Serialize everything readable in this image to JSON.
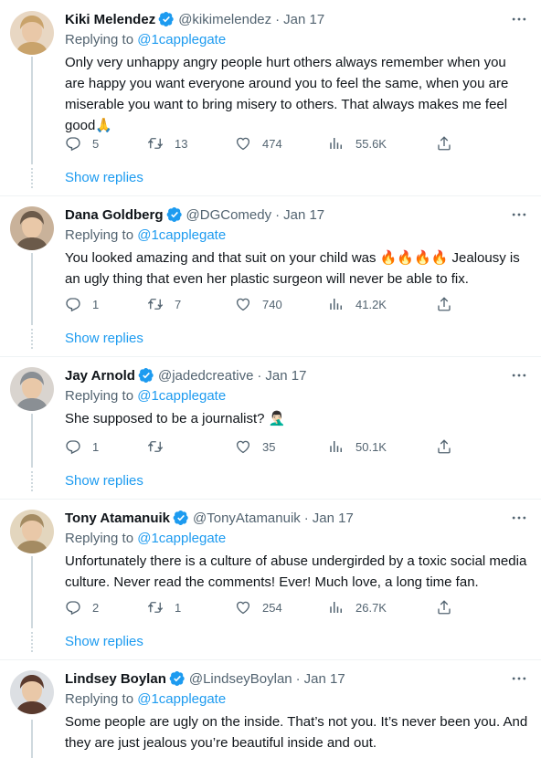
{
  "reply_prefix": "Replying to",
  "show_replies_label": "Show replies",
  "tweets": [
    {
      "name": "Kiki Melendez",
      "handle": "@kikimelendez",
      "date": "Jan 17",
      "replying_to": "@1capplegate",
      "text": "Only very unhappy angry people hurt others always remember when you are happy you want everyone around you to feel the same, when you are miserable you want to bring misery to others. That always makes me feel good🙏",
      "replies": "5",
      "retweets": "13",
      "likes": "474",
      "views": "55.6K",
      "avatar_colors": [
        "#c9a36b",
        "#e8d7c3"
      ]
    },
    {
      "name": "Dana Goldberg",
      "handle": "@DGComedy",
      "date": "Jan 17",
      "replying_to": "@1capplegate",
      "text": "You looked amazing and that suit on your child was 🔥🔥🔥🔥 Jealousy is an ugly thing that even her plastic surgeon will never be able to fix.",
      "replies": "1",
      "retweets": "7",
      "likes": "740",
      "views": "41.2K",
      "avatar_colors": [
        "#6b5a4a",
        "#c9b29a"
      ]
    },
    {
      "name": "Jay Arnold",
      "handle": "@jadedcreative",
      "date": "Jan 17",
      "replying_to": "@1capplegate",
      "text": "She supposed to be a journalist? 🤦🏻‍♂️",
      "replies": "1",
      "retweets": "",
      "likes": "35",
      "views": "50.1K",
      "avatar_colors": [
        "#8a8f94",
        "#d9d4cf"
      ]
    },
    {
      "name": "Tony Atamanuik",
      "handle": "@TonyAtamanuik",
      "date": "Jan 17",
      "replying_to": "@1capplegate",
      "text": "Unfortunately there is a culture of abuse undergirded by a toxic social media culture. Never read the comments!  Ever! Much love, a long time fan.",
      "replies": "2",
      "retweets": "1",
      "likes": "254",
      "views": "26.7K",
      "avatar_colors": [
        "#a48b62",
        "#e3d6be"
      ]
    },
    {
      "name": "Lindsey Boylan",
      "handle": "@LindseyBoylan",
      "date": "Jan 17",
      "replying_to": "@1capplegate",
      "text": "Some people are ugly on the inside. That’s not you. It’s never been you. And they are just jealous you’re beautiful inside and out.",
      "avatar_colors": [
        "#5a3a2e",
        "#dcdfe3"
      ]
    }
  ]
}
